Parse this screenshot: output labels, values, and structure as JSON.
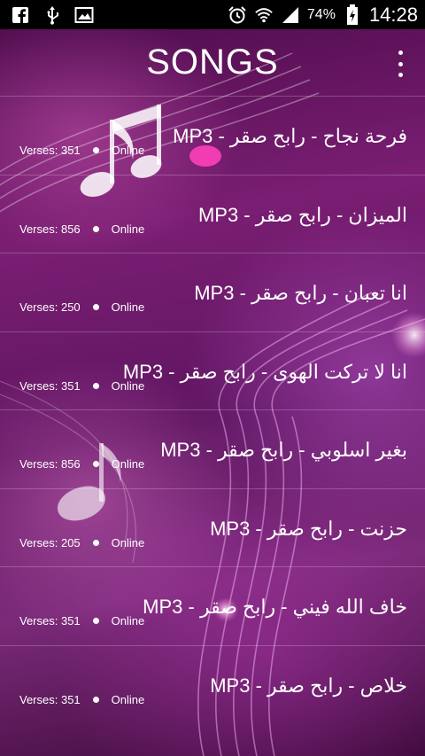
{
  "status_bar": {
    "battery_percent": "74%",
    "time": "14:28",
    "icons_left": [
      "facebook-icon",
      "usb-icon",
      "image-icon"
    ],
    "icons_right": [
      "alarm-icon",
      "wifi-icon",
      "signal-icon",
      "battery-icon"
    ]
  },
  "app_bar": {
    "title": "SONGS",
    "menu_icon": "overflow-menu-icon"
  },
  "songs": [
    {
      "title": "فرحة نجاح - رابح صقر - MP3",
      "verses": "Verses: 351",
      "status": "Online"
    },
    {
      "title": "الميزان - رابح صقر - MP3",
      "verses": "Verses: 856",
      "status": "Online"
    },
    {
      "title": "انا تعبان - رابح صقر - MP3",
      "verses": "Verses: 250",
      "status": "Online"
    },
    {
      "title": "انا لا تركت الهوى - رابح صقر - MP3",
      "verses": "Verses: 351",
      "status": "Online"
    },
    {
      "title": "بغير اسلوبي - رابح صقر - MP3",
      "verses": "Verses: 856",
      "status": "Online"
    },
    {
      "title": "حزنت - رابح صقر - MP3",
      "verses": "Verses: 205",
      "status": "Online"
    },
    {
      "title": "خاف الله فيني - رابح صقر - MP3",
      "verses": "Verses: 351",
      "status": "Online"
    },
    {
      "title": "خلاص - رابح صقر - MP3",
      "verses": "Verses: 351",
      "status": "Online"
    }
  ],
  "colors": {
    "status_bar_bg": "#000000",
    "background_accent": "#7a1e73",
    "text": "#ffffff"
  }
}
